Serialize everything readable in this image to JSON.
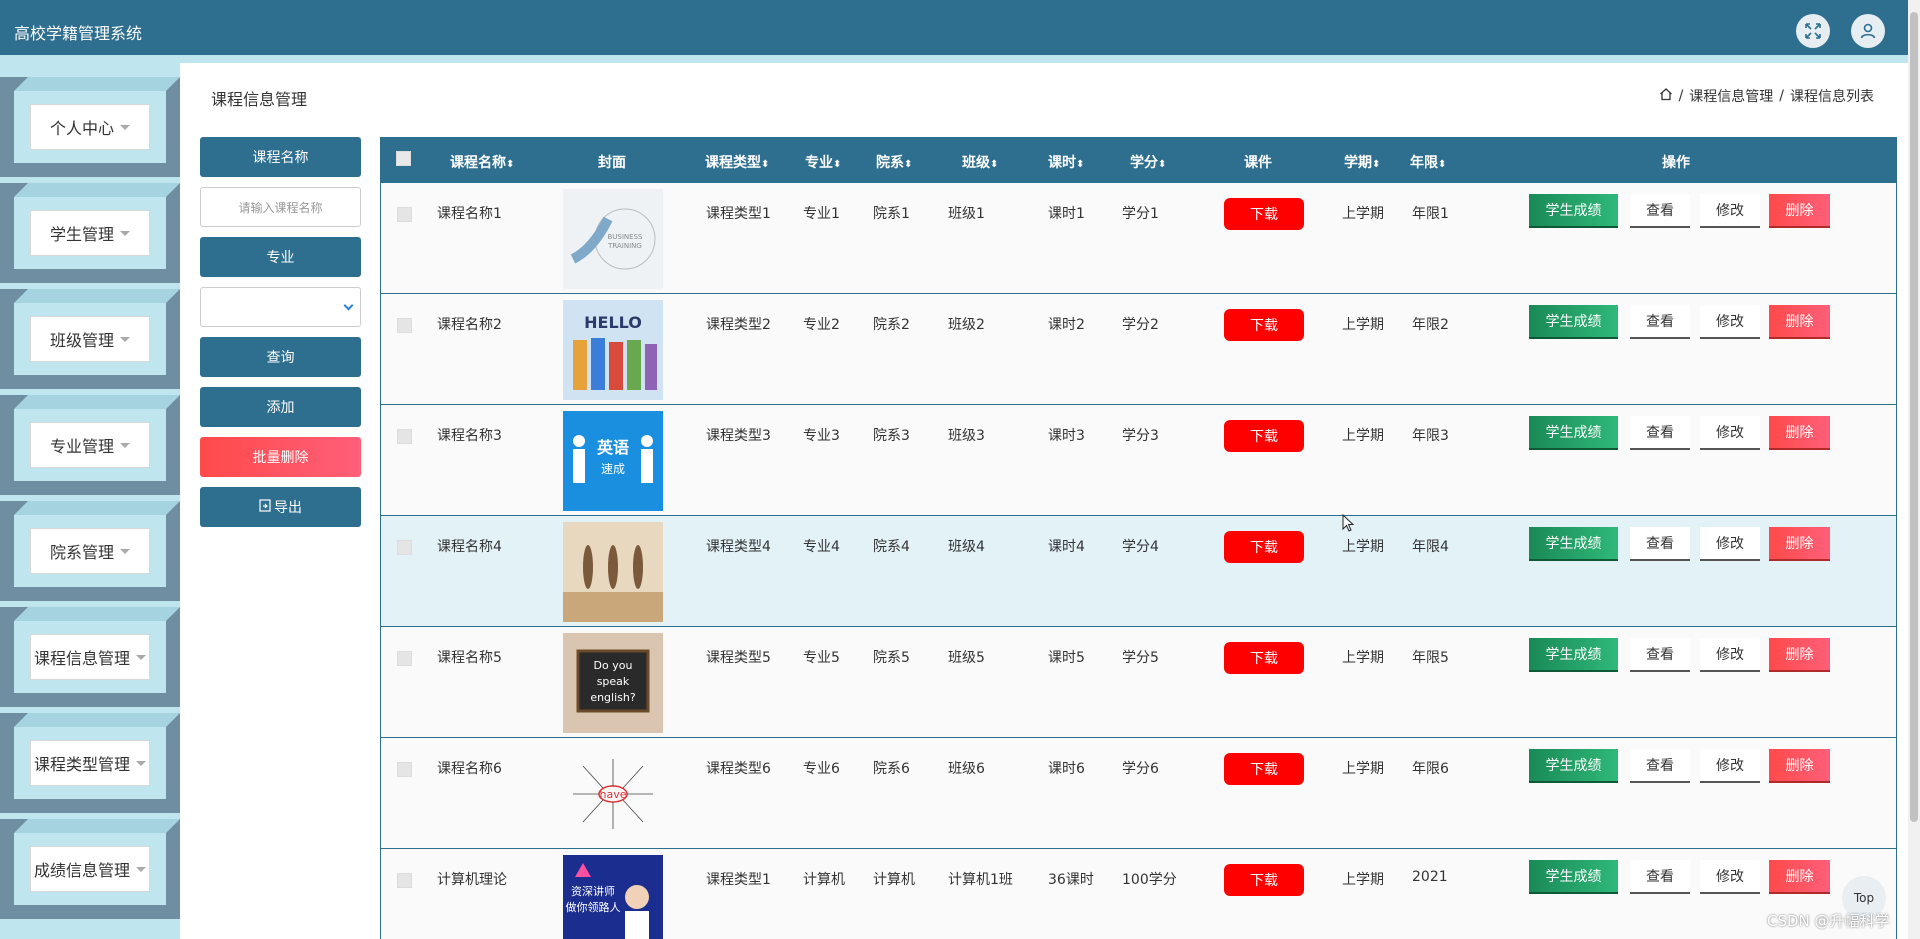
{
  "app": {
    "title": "高校学籍管理系统"
  },
  "sidebar": {
    "items": [
      {
        "label": "个人中心"
      },
      {
        "label": "学生管理"
      },
      {
        "label": "班级管理"
      },
      {
        "label": "专业管理"
      },
      {
        "label": "院系管理"
      },
      {
        "label": "课程信息管理"
      },
      {
        "label": "课程类型管理"
      },
      {
        "label": "成绩信息管理"
      }
    ]
  },
  "page": {
    "title": "课程信息管理",
    "breadcrumb": [
      "课程信息管理",
      "课程信息列表"
    ]
  },
  "filter": {
    "name_label": "课程名称",
    "name_placeholder": "请输入课程名称",
    "major_label": "专业",
    "major_value": "",
    "query_label": "查询",
    "add_label": "添加",
    "batch_delete_label": "批量删除",
    "export_label": "导出"
  },
  "table": {
    "headers": {
      "name": "课程名称",
      "cover": "封面",
      "type": "课程类型",
      "major": "专业",
      "dept": "院系",
      "class": "班级",
      "hours": "课时",
      "credit": "学分",
      "courseware": "课件",
      "term": "学期",
      "years": "年限",
      "actions": "操作"
    },
    "action_labels": {
      "download": "下载",
      "grades": "学生成绩",
      "view": "查看",
      "edit": "修改",
      "delete": "删除"
    },
    "rows": [
      {
        "name": "课程名称1",
        "type": "课程类型1",
        "major": "专业1",
        "dept": "院系1",
        "class": "班级1",
        "hours": "课时1",
        "credit": "学分1",
        "term": "上学期",
        "years": "年限1",
        "cover_text": "BUSINESS TRAINING"
      },
      {
        "name": "课程名称2",
        "type": "课程类型2",
        "major": "专业2",
        "dept": "院系2",
        "class": "班级2",
        "hours": "课时2",
        "credit": "学分2",
        "term": "上学期",
        "years": "年限2",
        "cover_text": "HELLO"
      },
      {
        "name": "课程名称3",
        "type": "课程类型3",
        "major": "专业3",
        "dept": "院系3",
        "class": "班级3",
        "hours": "课时3",
        "credit": "学分3",
        "term": "上学期",
        "years": "年限3",
        "cover_text": "英语"
      },
      {
        "name": "课程名称4",
        "type": "课程类型4",
        "major": "专业4",
        "dept": "院系4",
        "class": "班级4",
        "hours": "课时4",
        "credit": "学分4",
        "term": "上学期",
        "years": "年限4",
        "cover_text": ""
      },
      {
        "name": "课程名称5",
        "type": "课程类型5",
        "major": "专业5",
        "dept": "院系5",
        "class": "班级5",
        "hours": "课时5",
        "credit": "学分5",
        "term": "上学期",
        "years": "年限5",
        "cover_text": "Do you speak english?"
      },
      {
        "name": "课程名称6",
        "type": "课程类型6",
        "major": "专业6",
        "dept": "院系6",
        "class": "班级6",
        "hours": "课时6",
        "credit": "学分6",
        "term": "上学期",
        "years": "年限6",
        "cover_text": "have"
      },
      {
        "name": "计算机理论",
        "type": "课程类型1",
        "major": "计算机",
        "dept": "计算机",
        "class": "计算机1班",
        "hours": "36课时",
        "credit": "100学分",
        "term": "上学期",
        "years": "2021",
        "cover_text": "资深讲师"
      }
    ]
  },
  "misc": {
    "top_label": "Top",
    "watermark": "CSDN @升幅科学"
  },
  "colors": {
    "header": "#2e6e8f",
    "accent_red": "#ff0000",
    "grade_green": "#1a8a56",
    "sidebar_bg": "#bfe5ef"
  }
}
